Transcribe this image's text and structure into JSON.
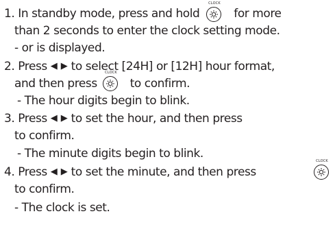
{
  "button_caption": "CLOCK",
  "icons": [
    "clock-light-button-icon",
    "left-arrow-icon",
    "right-arrow-icon"
  ],
  "lines": {
    "l1a": "1. In standby mode, press and hold",
    "l1b": "for more",
    "l2": "than 2 seconds to enter the clock setting mode.",
    "l3": "- or is displayed.",
    "l4a": "2. Press",
    "l4b": "to select [24H] or [12H] hour format,",
    "l5a": "and then press",
    "l5b": "to confirm.",
    "l6": "- The hour digits begin to blink.",
    "l7a": "3. Press",
    "l7b": "to set the hour, and then press",
    "l8": "to confirm.",
    "l9": "- The minute digits begin to blink.",
    "l10a": "4. Press",
    "l10b": "to set the minute, and then press",
    "l11": "to confirm.",
    "l12": "- The clock is set."
  }
}
